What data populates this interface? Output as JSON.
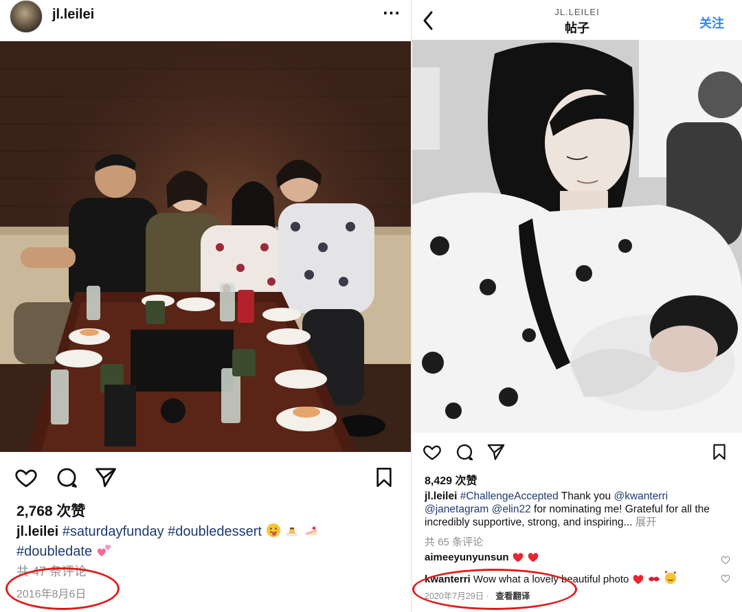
{
  "left_post": {
    "username": "jl.leilei",
    "more_icon": "more-horizontal-icon",
    "likes": "2,768 次赞",
    "caption": {
      "user": "jl.leilei",
      "tags": [
        "#saturdayfunday",
        "#doubledessert",
        "#doubledate"
      ],
      "emojis": [
        "tongue-face-emoji",
        "pudding-emoji",
        "cake-emoji",
        "two-hearts-emoji"
      ]
    },
    "comments_count": "共 47 条评论",
    "date": "2016年8月6日",
    "icons": [
      "heart-icon",
      "comment-icon",
      "share-icon",
      "bookmark-icon"
    ]
  },
  "right_post": {
    "header_username": "JL.LEILEI",
    "header_title": "帖子",
    "follow_label": "关注",
    "likes": "8,429 次赞",
    "caption": {
      "user": "jl.leilei",
      "tag": "#ChallengeAccepted",
      "text1": "Thank you",
      "mention1": "@kwanterri",
      "mention2": "@janetagram",
      "mention3": "@elin22",
      "text2": "for nominating me! Grateful for all the incredibly supportive, strong, and inspiring...",
      "expand": "展开"
    },
    "comments_count": "共 65 条评论",
    "comments": [
      {
        "user": "aimeeyunyunsun",
        "text": "",
        "emojis": [
          "heart-emoji",
          "heart-emoji"
        ]
      },
      {
        "user": "kwanterri",
        "text": "Wow what a lovely beautiful photo",
        "emojis": [
          "heart-emoji",
          "kiss-mark-emoji",
          "smiling-hearts-emoji"
        ]
      }
    ],
    "date": "2020年7月29日",
    "date_sep": "·",
    "translate": "查看翻译",
    "icons": [
      "heart-icon",
      "comment-icon",
      "share-icon",
      "bookmark-icon"
    ]
  },
  "colors": {
    "hashtag": "#1e3a6e",
    "follow": "#2f88e8",
    "muted": "#8e8e8e",
    "highlight_oval": "#e01b1b"
  }
}
